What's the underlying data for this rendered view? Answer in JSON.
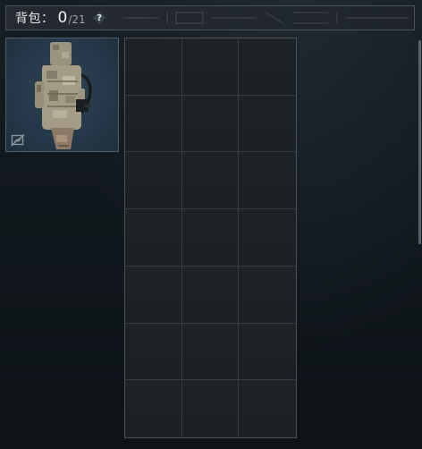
{
  "header": {
    "label": "背包：",
    "count": "0",
    "max": "/21",
    "help_symbol": "?"
  },
  "backpack": {
    "item_icon": "tactical-backpack-icon",
    "unequip_icon": "unequip-icon",
    "card_color": "#26394a"
  },
  "grid": {
    "columns": 3,
    "rows": 7,
    "capacity": 21,
    "cell_color": "#1e2327",
    "line_color": "#353c42"
  },
  "colors": {
    "background": "#11181d",
    "border": "#4a535a",
    "text": "#e6e8ea"
  }
}
